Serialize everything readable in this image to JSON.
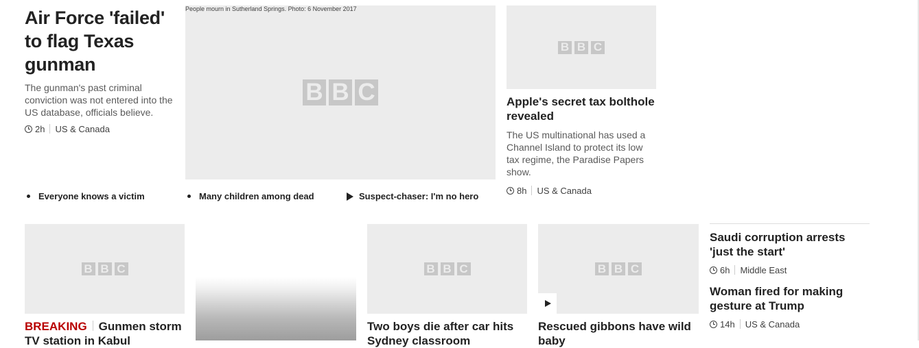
{
  "top_story": {
    "headline": "Air Force 'failed' to flag Texas gunman",
    "summary": "The gunman's past criminal conviction was not entered into the US database, officials believe.",
    "time": "2h",
    "section": "US & Canada",
    "image_caption": "People mourn in Sutherland Springs. Photo: 6 November 2017",
    "image_logo": [
      "B",
      "B",
      "C"
    ]
  },
  "related_links": [
    {
      "label": "Everyone knows a victim",
      "icon": "bullet"
    },
    {
      "label": "Many children among dead",
      "icon": "bullet"
    },
    {
      "label": "Suspect-chaser: I'm no hero",
      "icon": "play-icon"
    }
  ],
  "side_story": {
    "headline": "Apple's secret tax bolthole revealed",
    "summary": "The US multinational has used a Channel Island to protect its low tax regime, the Paradise Papers show.",
    "time": "8h",
    "section": "US & Canada"
  },
  "bottom_stories": [
    {
      "prefix": "BREAKING",
      "headline": "Gunmen storm TV station in Kabul"
    },
    {
      "headline": ""
    },
    {
      "headline": "Two boys die after car hits Sydney classroom"
    },
    {
      "headline": "Rescued gibbons have wild baby"
    }
  ],
  "text_stories": [
    {
      "headline": "Saudi corruption arrests 'just the start'",
      "time": "6h",
      "section": "Middle East"
    },
    {
      "headline": "Woman fired for making gesture at Trump",
      "time": "14h",
      "section": "US & Canada"
    }
  ],
  "colors": {
    "breaking": "#b80000",
    "placeholder": "#ececec",
    "logo": "#c7c7c7"
  }
}
